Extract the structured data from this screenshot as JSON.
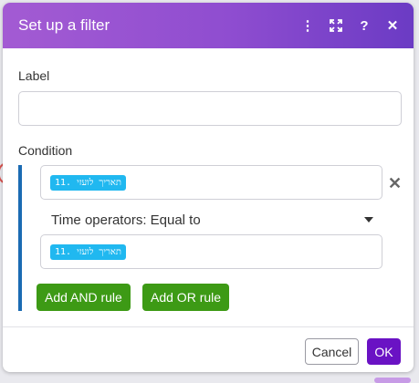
{
  "dialog": {
    "title": "Set up a filter",
    "icons": [
      "more-vertical-icon",
      "expand-icon",
      "help-icon",
      "close-icon"
    ]
  },
  "label_field": {
    "label": "Label",
    "value": ""
  },
  "condition": {
    "label": "Condition",
    "operand_a": "11. תאריך לועזי",
    "operator": "Time operators: Equal to",
    "operand_b": "11. תאריך לועזי",
    "add_and_label": "Add AND rule",
    "add_or_label": "Add OR rule"
  },
  "footer": {
    "cancel_label": "Cancel",
    "ok_label": "OK"
  },
  "colors": {
    "header_start": "#a35bd3",
    "header_end": "#6b3bc4",
    "pill": "#20b8f0",
    "rule_button": "#3d9a15",
    "ok_button": "#6a12c4",
    "condition_bar": "#1b6bb3"
  }
}
